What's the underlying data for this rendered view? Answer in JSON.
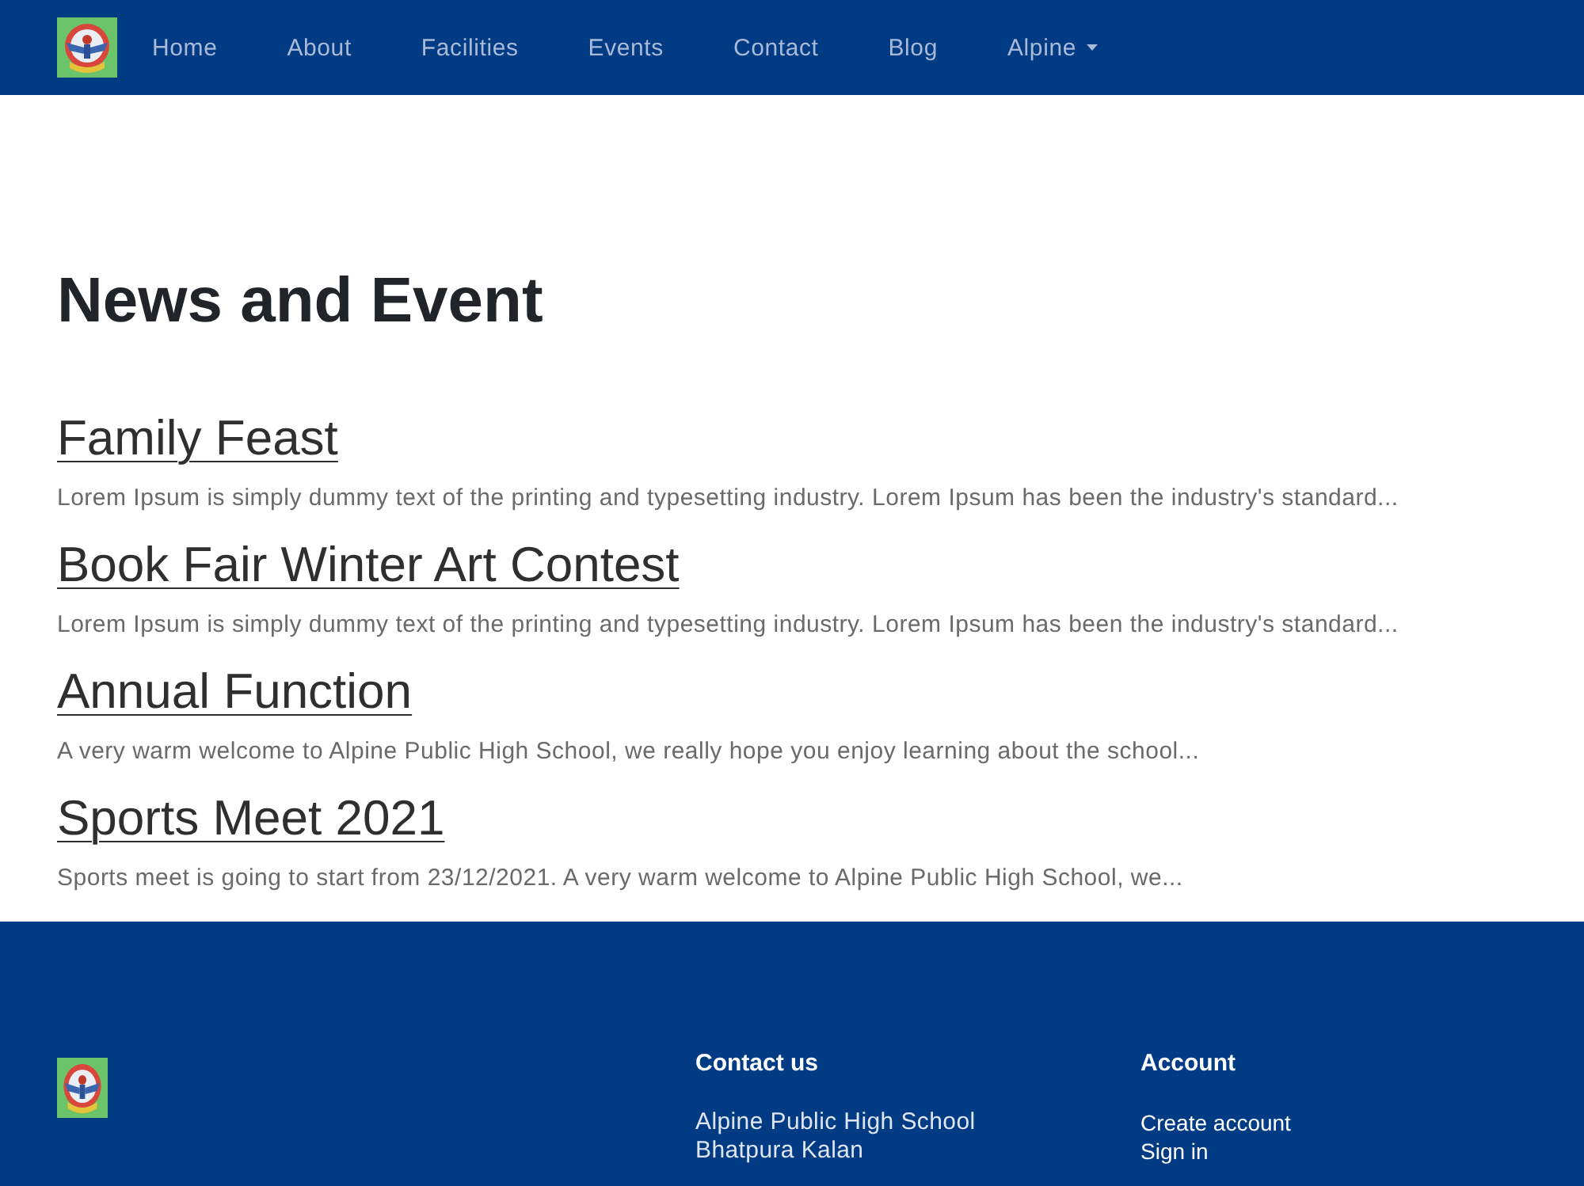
{
  "navbar": {
    "items": [
      {
        "label": "Home",
        "kind": "link"
      },
      {
        "label": "About",
        "kind": "link"
      },
      {
        "label": "Facilities",
        "kind": "link"
      },
      {
        "label": "Events",
        "kind": "link"
      },
      {
        "label": "Contact",
        "kind": "link"
      },
      {
        "label": "Blog",
        "kind": "link"
      },
      {
        "label": "Alpine",
        "kind": "dropdown"
      }
    ]
  },
  "main": {
    "heading": "News and Event",
    "events": [
      {
        "title": "Family Feast",
        "summary": "Lorem Ipsum is simply dummy text of the printing and typesetting industry. Lorem Ipsum has been the industry's standard..."
      },
      {
        "title": "Book Fair Winter Art Contest",
        "summary": "Lorem Ipsum is simply dummy text of the printing and typesetting industry. Lorem Ipsum has been the industry's standard..."
      },
      {
        "title": "Annual Function",
        "summary": "A very warm welcome to Alpine Public High School, we really hope you enjoy learning about the school..."
      },
      {
        "title": "Sports Meet 2021",
        "summary": "Sports meet is going to start from 23/12/2021. A very warm welcome to Alpine Public High School, we..."
      }
    ]
  },
  "footer": {
    "columns": [
      {
        "heading": "Contact us",
        "kind": "address",
        "items": [
          "Alpine Public High School",
          "Bhatpura Kalan"
        ]
      },
      {
        "heading": "Account",
        "kind": "links",
        "items": [
          "Create account",
          "Sign in"
        ]
      }
    ]
  }
}
